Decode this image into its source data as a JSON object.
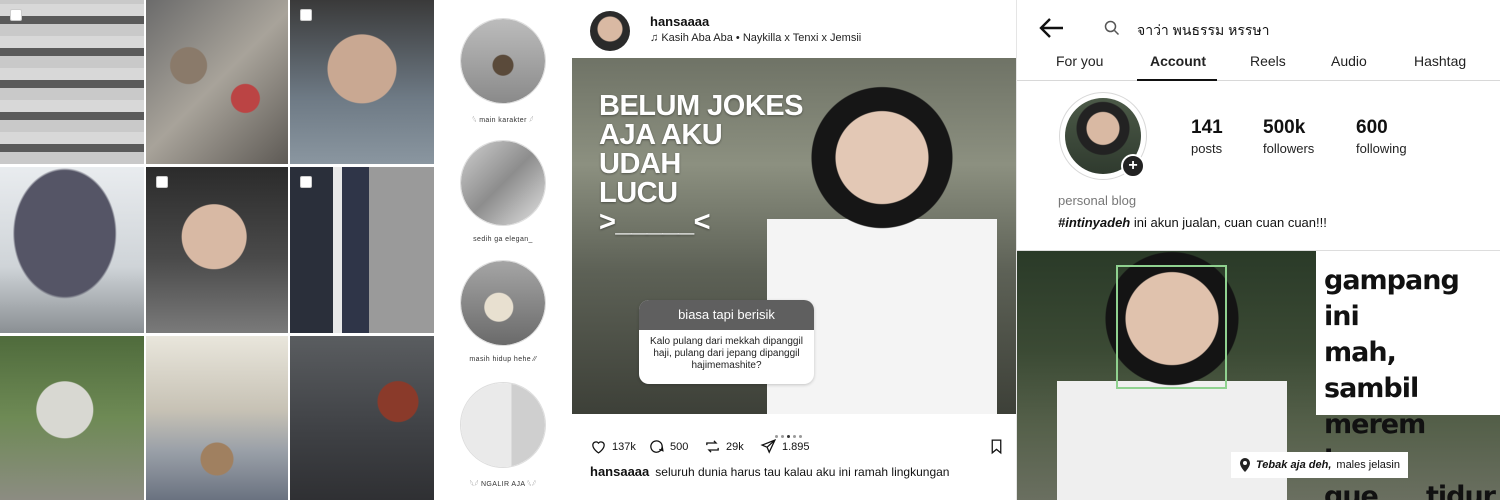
{
  "grid": {
    "tiles": [
      {
        "name": "sunglasses-display-photo",
        "selectable": true
      },
      {
        "name": "table-clutter-photo",
        "selectable": false
      },
      {
        "name": "guy-with-shades-photo",
        "selectable": true
      },
      {
        "name": "umbrella-street-photo",
        "selectable": false
      },
      {
        "name": "guy-in-car-photo",
        "selectable": true
      },
      {
        "name": "books-basket-photo",
        "selectable": true
      },
      {
        "name": "garden-statue-photo",
        "selectable": false
      },
      {
        "name": "cat-patio-photo",
        "selectable": false
      },
      {
        "name": "stone-wall-photo",
        "selectable": false
      }
    ]
  },
  "highlights": [
    {
      "label": "𓆩 main karakter 𓆪"
    },
    {
      "label": "sedih ga elegan_"
    },
    {
      "label": "masih hidup hehe ⁄⁄"
    },
    {
      "label": "𓆩𓆪 NGALIR AJA 𓆩𓆪"
    }
  ],
  "post": {
    "username": "hansaaaa",
    "music": "Kasih Aba Aba • Naykilla x Tenxi x Jemsii",
    "headline_lines": [
      "BELUM JOKES",
      "AJA AKU",
      "UDAH",
      "LUCU",
      ">_____<"
    ],
    "question_title": "biasa tapi berisik",
    "question_text": "Kalo pulang dari mekkah dipanggil haji, pulang dari jepang dipanggil hajimemashite?",
    "carousel_dots": 5,
    "carousel_active": 2,
    "likes": "137k",
    "comments": "500",
    "reposts": "29k",
    "shares": "1.895",
    "caption_user": "hansaaaa",
    "caption_text": "seluruh dunia harus tau kalau aku ini ramah lingkungan"
  },
  "profile": {
    "search_query": "จาว่า พนธรรม หรรษา",
    "tabs": [
      "For you",
      "Account",
      "Reels",
      "Audio",
      "Hashtag"
    ],
    "active_tab": "Account",
    "posts_count": "141",
    "posts_label": "posts",
    "followers_count": "500k",
    "followers_label": "followers",
    "following_count": "600",
    "following_label": "following",
    "category": "personal blog",
    "bio_tag": "#intinyadeh",
    "bio_text": "ini akun jualan, cuan cuan cuan!!!",
    "meme_lines": [
      "gampang ini",
      "mah, sambil",
      "merem juga",
      "gue tidur"
    ],
    "location_bold": "Tebak aja deh,",
    "location_text": "males jelasin"
  },
  "colors": {
    "question_header": "#5f5f5f",
    "face_box": "#8fd18f"
  }
}
